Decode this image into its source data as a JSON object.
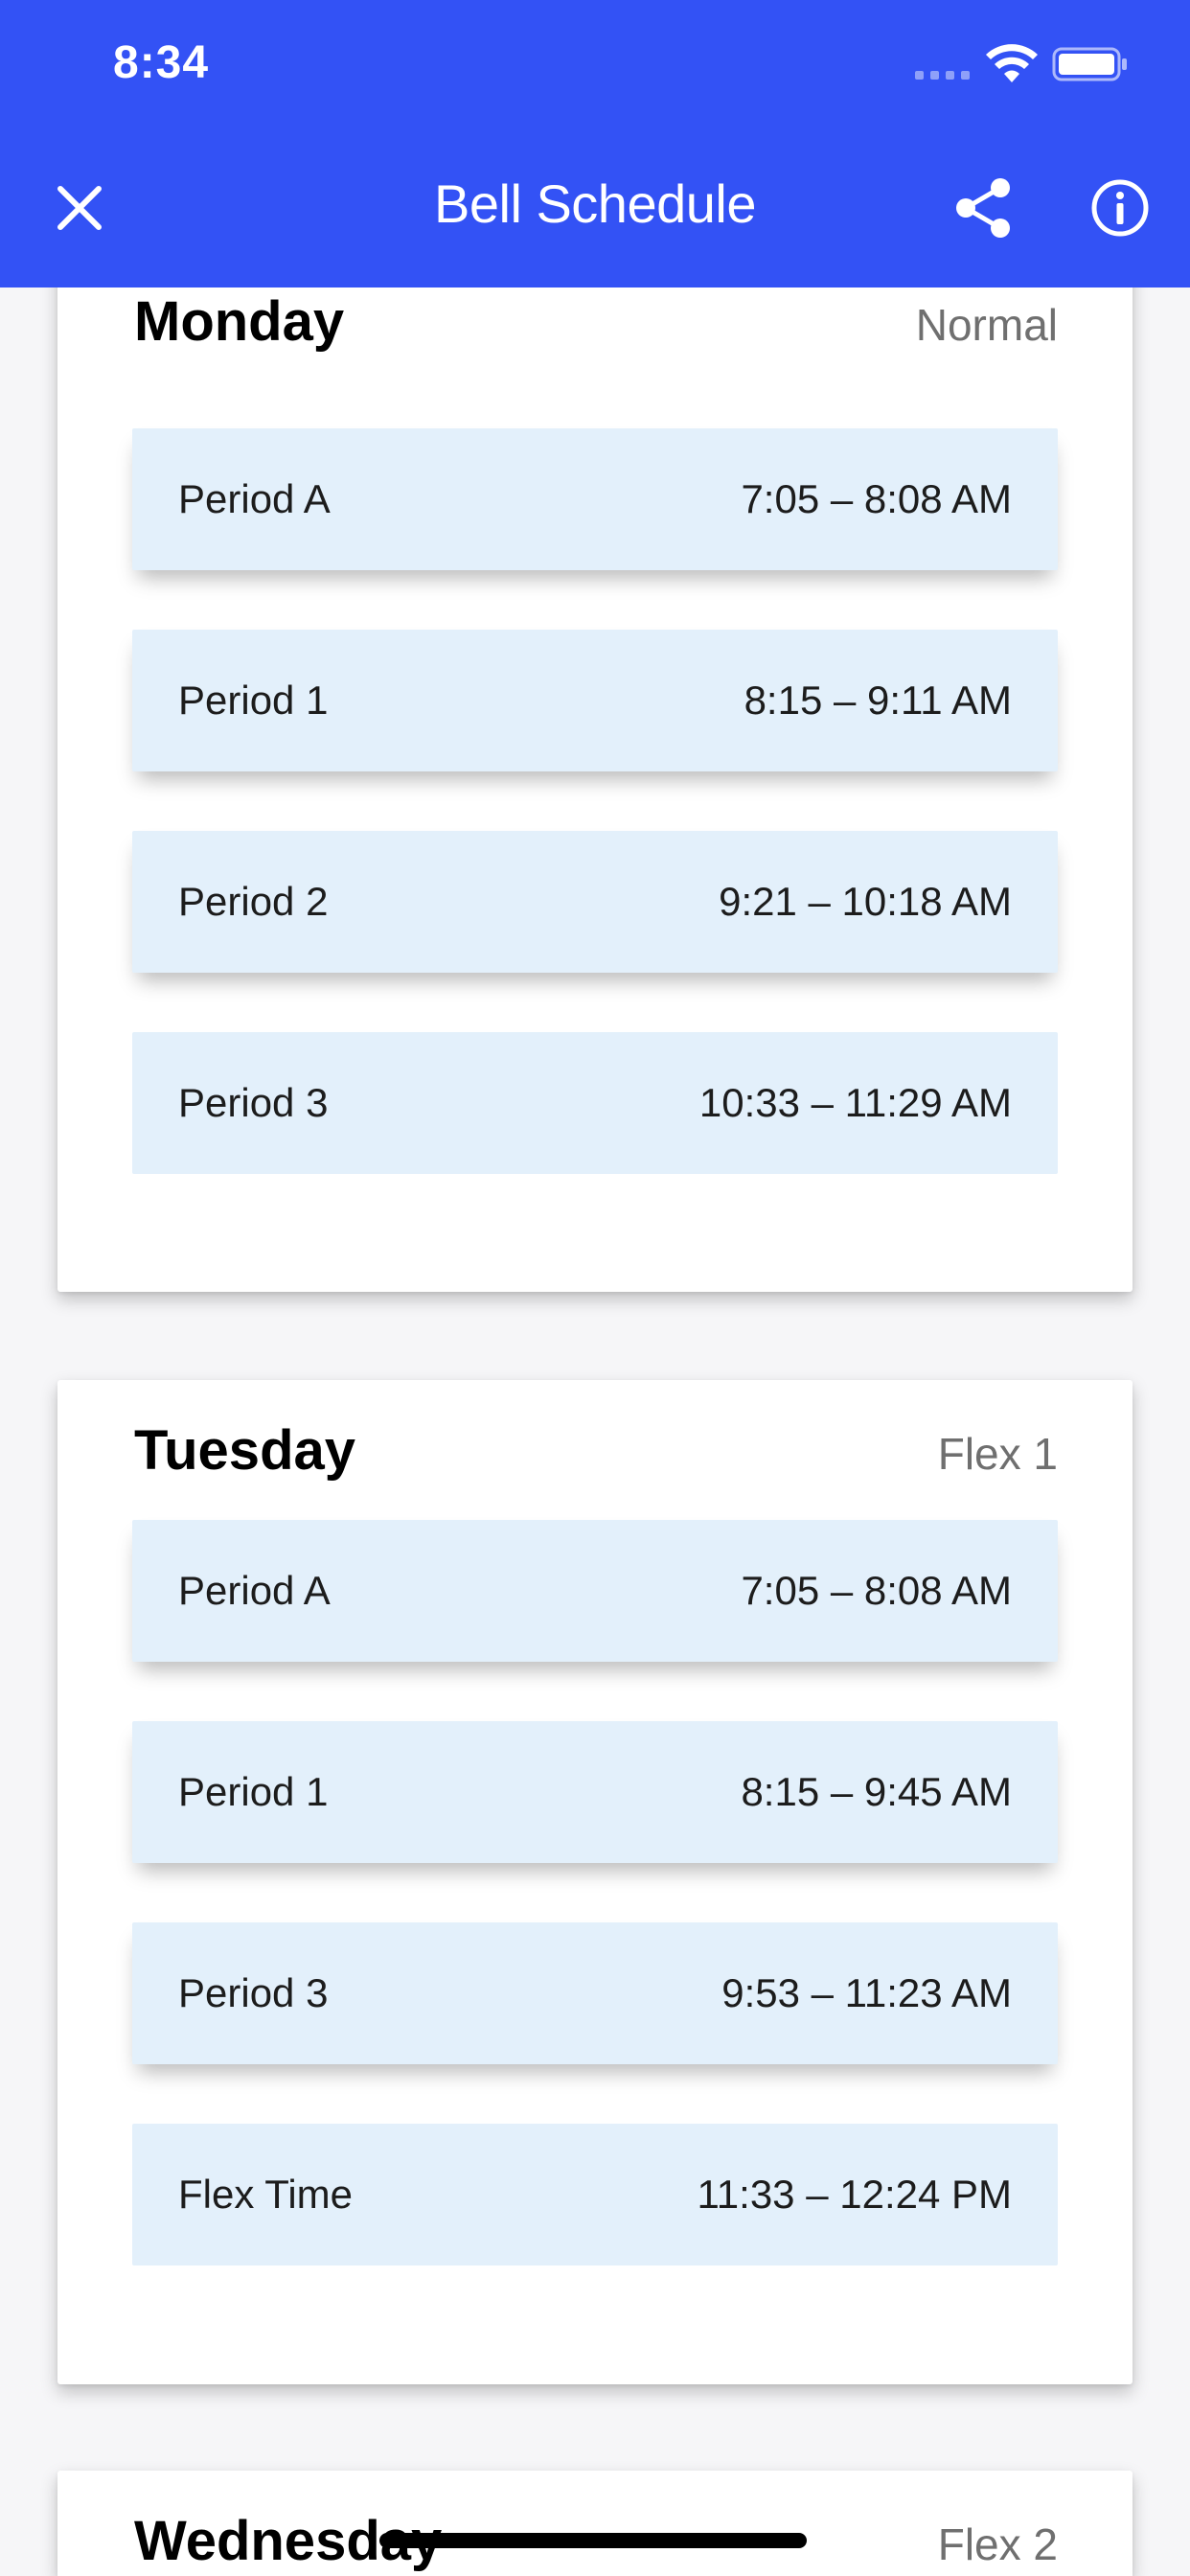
{
  "status_bar": {
    "time": "8:34"
  },
  "nav": {
    "title": "Bell Schedule"
  },
  "days": [
    {
      "day": "Monday",
      "type": "Normal",
      "periods": [
        {
          "name": "Period A",
          "time": "7:05 – 8:08 AM"
        },
        {
          "name": "Period 1",
          "time": "8:15 – 9:11 AM"
        },
        {
          "name": "Period 2",
          "time": "9:21 – 10:18 AM"
        },
        {
          "name": "Period 3",
          "time": "10:33 – 11:29 AM"
        }
      ]
    },
    {
      "day": "Tuesday",
      "type": "Flex 1",
      "periods": [
        {
          "name": "Period A",
          "time": "7:05 – 8:08 AM"
        },
        {
          "name": "Period 1",
          "time": "8:15 – 9:45 AM"
        },
        {
          "name": "Period 3",
          "time": "9:53 – 11:23 AM"
        },
        {
          "name": "Flex Time",
          "time": "11:33 – 12:24 PM"
        }
      ]
    },
    {
      "day": "Wednesday",
      "type": "Flex 2",
      "periods": []
    }
  ],
  "colors": {
    "header": "#3352f5",
    "period_background": "#e3f0fb",
    "background": "#f6f6f8"
  }
}
